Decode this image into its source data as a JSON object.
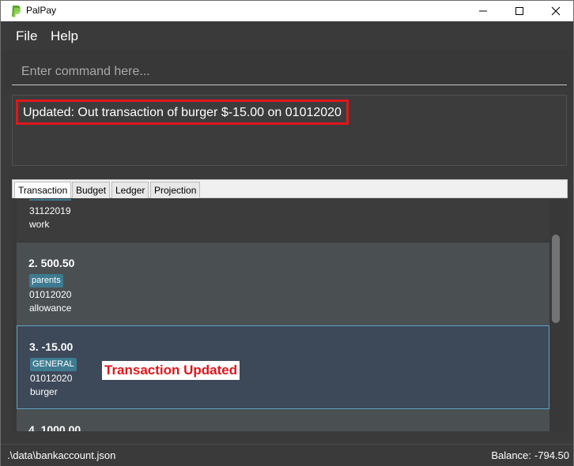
{
  "window": {
    "title": "PalPay",
    "icons": [
      "paypal-logo-icon",
      "minimize-icon",
      "maximize-icon",
      "close-icon"
    ]
  },
  "menu": {
    "file": "File",
    "help": "Help"
  },
  "command": {
    "placeholder": "Enter command here...",
    "value": ""
  },
  "result": {
    "message": "Updated: Out transaction of burger $-15.00 on 01012020"
  },
  "tabs": [
    {
      "label": "Transaction",
      "active": true
    },
    {
      "label": "Budget",
      "active": false
    },
    {
      "label": "Ledger",
      "active": false
    },
    {
      "label": "Projection",
      "active": false
    }
  ],
  "transactions": [
    {
      "date": "31122019",
      "description": "work"
    },
    {
      "title": "2.  500.50",
      "tag": "parents",
      "date": "01012020",
      "description": "allowance"
    },
    {
      "title": "3.  -15.00",
      "tag": "GENERAL",
      "date": "01012020",
      "description": "burger",
      "selected": true
    },
    {
      "title": "4.  1000.00"
    }
  ],
  "annotation": {
    "text": "Transaction Updated"
  },
  "status": {
    "file_path": ".\\data\\bankaccount.json",
    "balance_label": "Balance:",
    "balance_value": "-794.50"
  },
  "colors": {
    "accent_red": "#e0161b",
    "tag_blue": "#3e7b91",
    "selected_border": "#5ea3c4"
  }
}
